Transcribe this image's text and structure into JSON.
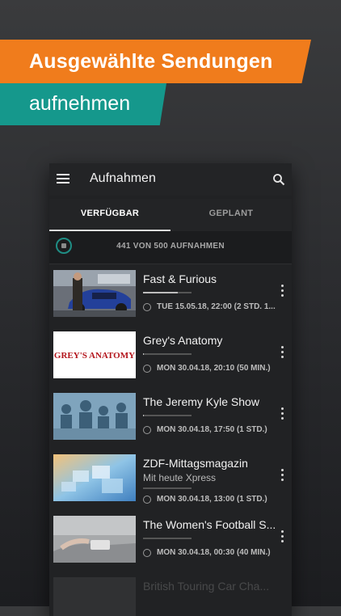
{
  "promo": {
    "line1": "Ausgewählte Sendungen",
    "line2": "aufnehmen"
  },
  "appbar": {
    "title": "Aufnahmen",
    "menu_icon": "hamburger-menu-icon",
    "search_icon": "search-icon"
  },
  "tabs": [
    {
      "label": "VERFÜGBAR",
      "active": true
    },
    {
      "label": "GEPLANT",
      "active": false
    }
  ],
  "storage": {
    "text": "441 VON 500 AUFNAHMEN",
    "used": 441,
    "total": 500
  },
  "recordings": [
    {
      "title": "Fast & Furious",
      "subtitle": "",
      "progress": 0.72,
      "meta": "TUE 15.05.18, 22:00 (2 STD. 1..."
    },
    {
      "title": "Grey's Anatomy",
      "subtitle": "",
      "progress": 0.02,
      "meta": "MON 30.04.18, 20:10 (50 MIN.)",
      "logo": "GREY'S ANATOMY"
    },
    {
      "title": "The Jeremy Kyle Show",
      "subtitle": "",
      "progress": 0.02,
      "meta": "MON 30.04.18, 17:50 (1 STD.)"
    },
    {
      "title": "ZDF-Mittagsmagazin",
      "subtitle": "Mit heute Xpress",
      "progress": 0.0,
      "meta": "MON 30.04.18, 13:00 (1 STD.)"
    },
    {
      "title": "The Women's Football S...",
      "subtitle": "",
      "progress": 0.0,
      "meta": "MON 30.04.18, 00:30 (40 MIN.)"
    },
    {
      "title": "British Touring Car Cha...",
      "subtitle": "",
      "progress": 0.0,
      "meta": ""
    }
  ],
  "colors": {
    "orange": "#f07c1c",
    "teal": "#15988c",
    "panel": "#212224"
  }
}
